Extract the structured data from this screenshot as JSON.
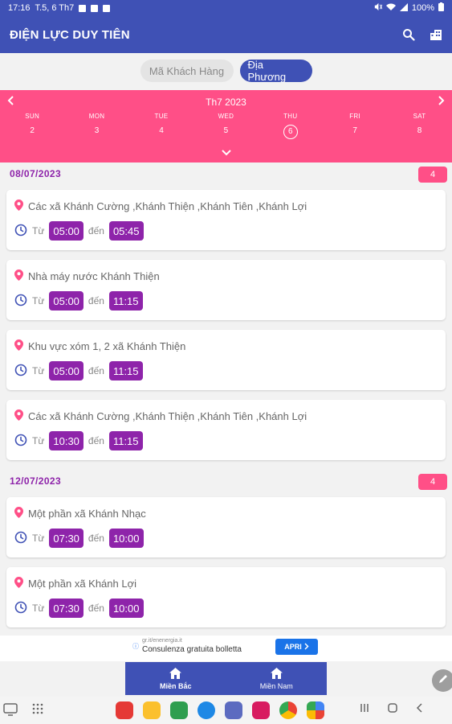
{
  "status": {
    "time": "17:16",
    "date": "T.5, 6 Th7",
    "battery": "100%"
  },
  "appbar": {
    "title": "ĐIỆN LỰC DUY TIÊN",
    "search_icon": "search-icon",
    "building_icon": "building-icon"
  },
  "segment": {
    "customer_label": "Mã Khách Hàng",
    "local_label": "Địa Phương",
    "selected": "Địa Phương"
  },
  "calendar": {
    "month": "Th7 2023",
    "days": [
      {
        "name": "SUN",
        "num": "2"
      },
      {
        "name": "MON",
        "num": "3"
      },
      {
        "name": "TUE",
        "num": "4"
      },
      {
        "name": "WED",
        "num": "5"
      },
      {
        "name": "THU",
        "num": "6"
      },
      {
        "name": "FRI",
        "num": "7"
      },
      {
        "name": "SAT",
        "num": "8"
      }
    ],
    "selected_day": "6"
  },
  "labels": {
    "from": "Từ",
    "to": "đến"
  },
  "groups": [
    {
      "date": "08/07/2023",
      "count": "4",
      "items": [
        {
          "location": "Các xã Khánh Cường ,Khánh Thiện ,Khánh Tiên ,Khánh Lợi",
          "start": "05:00",
          "end": "05:45"
        },
        {
          "location": "Nhà máy nước Khánh Thiện",
          "start": "05:00",
          "end": "11:15"
        },
        {
          "location": "Khu vực xóm 1, 2 xã Khánh Thiện",
          "start": "05:00",
          "end": "11:15"
        },
        {
          "location": "Các xã Khánh Cường ,Khánh Thiện ,Khánh Tiên ,Khánh Lợi",
          "start": "10:30",
          "end": "11:15"
        }
      ]
    },
    {
      "date": "12/07/2023",
      "count": "4",
      "items": [
        {
          "location": "Một phần xã Khánh Nhạc",
          "start": "07:30",
          "end": "10:00"
        },
        {
          "location": "Một phần xã Khánh Lợi",
          "start": "07:30",
          "end": "10:00"
        }
      ]
    }
  ],
  "ad": {
    "source": "gr.it/enenergia.it",
    "text": "Consulenza gratuita bolletta",
    "cta": "APRI"
  },
  "bottomnav": {
    "north_label": "Miền Bắc",
    "south_label": "Miền Nam",
    "active": "Miền Bắc"
  },
  "colors": {
    "primary": "#3f51b5",
    "accent_pink": "#ff4f87",
    "purple": "#8e24aa"
  }
}
